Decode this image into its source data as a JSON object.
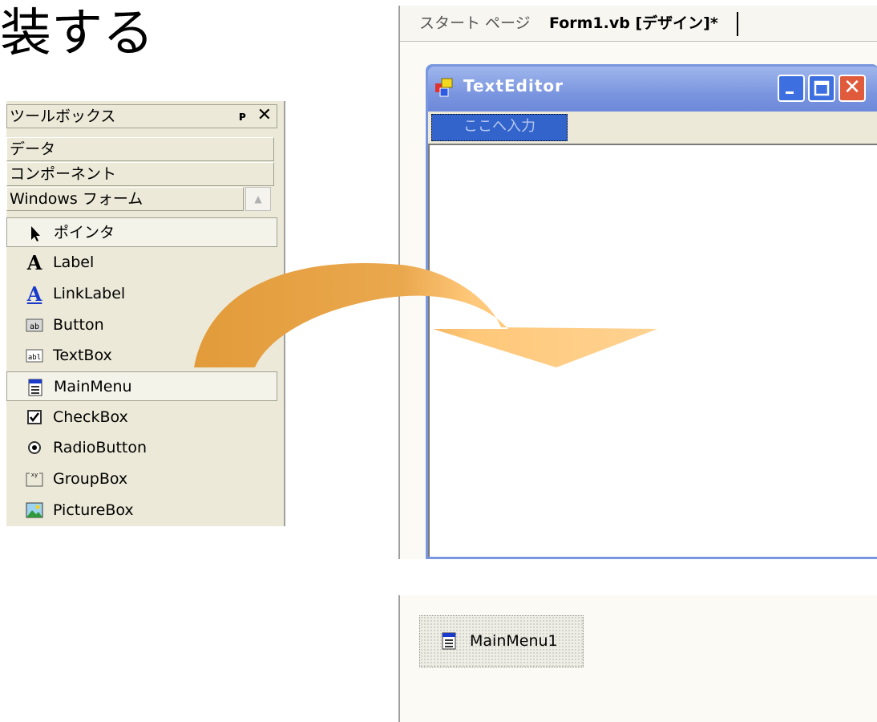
{
  "heading": "装する",
  "toolbox": {
    "title": "ツールボックス",
    "pin_glyph": "ᵖ",
    "close_glyph": "✕",
    "categories": [
      "データ",
      "コンポーネント",
      "Windows フォーム"
    ],
    "scroll_up_glyph": "▲",
    "items": [
      "ポインタ",
      "Label",
      "LinkLabel",
      "Button",
      "TextBox",
      "MainMenu",
      "CheckBox",
      "RadioButton",
      "GroupBox",
      "PictureBox"
    ]
  },
  "designer": {
    "tabs": [
      "スタート ページ",
      "Form1.vb [デザイン]*"
    ],
    "form": {
      "title": "TextEditor",
      "menu_placeholder": "ここへ入力"
    },
    "tray": {
      "component_label": "MainMenu1"
    }
  },
  "colors": {
    "arrow_dark": "#e29b3a",
    "arrow_light": "#ffcc80",
    "titlebar": "#7b96df",
    "close_button": "#e05a3c"
  }
}
